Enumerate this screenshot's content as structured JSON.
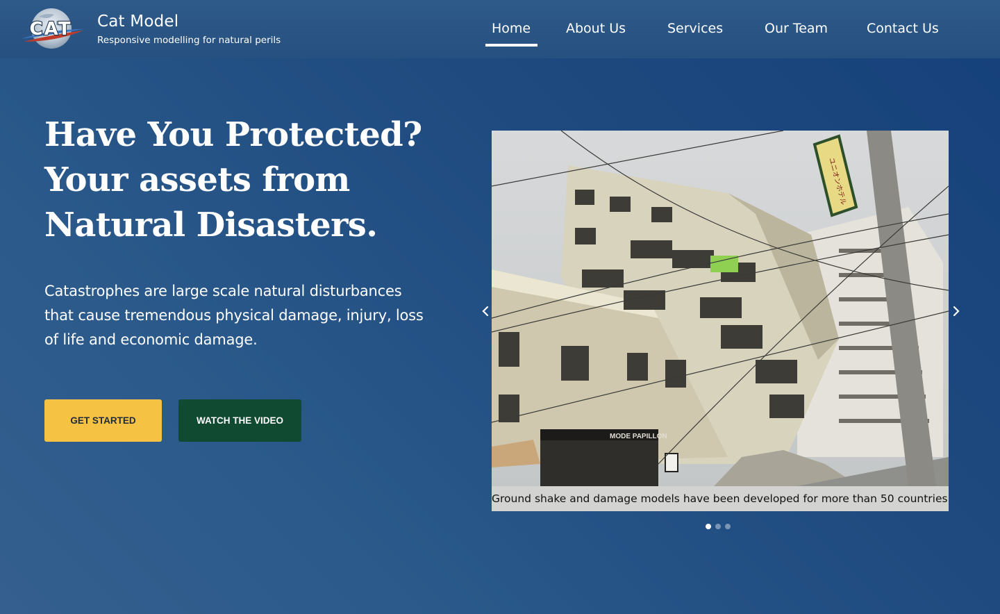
{
  "brand": {
    "logo_text": "CAT",
    "name": "Cat Model",
    "tagline": "Responsive modelling for natural perils"
  },
  "nav": {
    "items": [
      {
        "label": "Home",
        "active": true
      },
      {
        "label": "About Us",
        "active": false
      },
      {
        "label": "Services",
        "active": false
      },
      {
        "label": "Our Team",
        "active": false
      },
      {
        "label": "Contact Us",
        "active": false
      }
    ]
  },
  "hero": {
    "title_lines": [
      "Have You Protected?",
      "Your assets from",
      "Natural Disasters."
    ],
    "description": "Catastrophes are large scale natural disturbances that cause tremendous physical damage, injury, loss of life and economic damage.",
    "primary_button": "GET STARTED",
    "secondary_button": "WATCH THE VIDEO"
  },
  "carousel": {
    "caption": "Ground shake and damage models have been developed for more than 50 countries.",
    "image_description_icon": "earthquake-damaged-building-photo",
    "shop_sign": "MODE PAPILLON",
    "hotel_sign": "ユニオンホテル",
    "slide_count": 3,
    "active_slide": 1,
    "prev_icon": "chevron-left-icon",
    "next_icon": "chevron-right-icon"
  },
  "colors": {
    "background": "#1f4b80",
    "header": "#2b5786",
    "primary_button": "#f6c244",
    "secondary_button": "#104a31"
  }
}
